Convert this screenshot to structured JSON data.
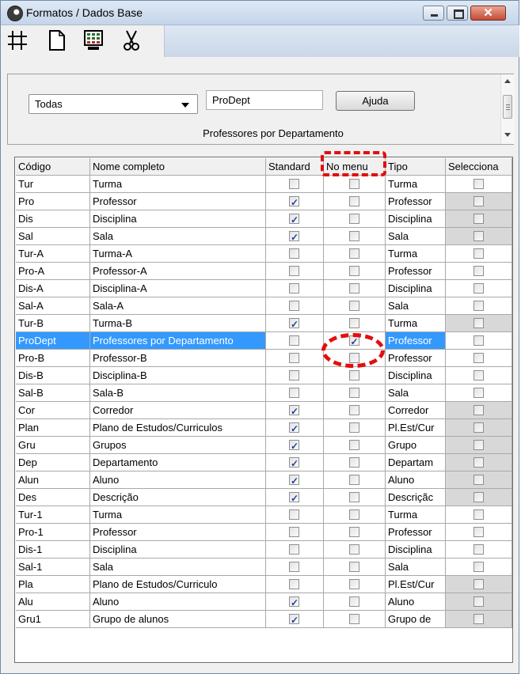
{
  "window": {
    "title": "Formatos / Dados Base",
    "icons": {
      "app": "app-clock-icon",
      "minimize": "minimize-icon",
      "maximize": "maximize-icon",
      "close": "close-icon"
    },
    "close_glyph": "✕"
  },
  "toolbar": {
    "icons": [
      "grid-icon",
      "new-document-icon",
      "monitor-icon",
      "scissors-icon"
    ]
  },
  "filter": {
    "category_selected": "Todas",
    "code_value": "ProDept",
    "help_label": "Ajuda",
    "description": "Professores por Departamento"
  },
  "grid": {
    "columns": [
      "Código",
      "Nome completo",
      "Standard",
      "No menu",
      "Tipo",
      "Selecciona"
    ],
    "rows": [
      {
        "code": "Tur",
        "name": "Turma",
        "standard": false,
        "menu": false,
        "type": "Turma",
        "select": false,
        "select_gray": false
      },
      {
        "code": "Pro",
        "name": "Professor",
        "standard": true,
        "menu": false,
        "type": "Professor",
        "select": false,
        "select_gray": true
      },
      {
        "code": "Dis",
        "name": "Disciplina",
        "standard": true,
        "menu": false,
        "type": "Disciplina",
        "select": false,
        "select_gray": true
      },
      {
        "code": "Sal",
        "name": "Sala",
        "standard": true,
        "menu": false,
        "type": "Sala",
        "select": false,
        "select_gray": true
      },
      {
        "code": "Tur-A",
        "name": "Turma-A",
        "standard": false,
        "menu": false,
        "type": "Turma",
        "select": false,
        "select_gray": false
      },
      {
        "code": "Pro-A",
        "name": "Professor-A",
        "standard": false,
        "menu": false,
        "type": "Professor",
        "select": false,
        "select_gray": false
      },
      {
        "code": "Dis-A",
        "name": "Disciplina-A",
        "standard": false,
        "menu": false,
        "type": "Disciplina",
        "select": false,
        "select_gray": false
      },
      {
        "code": "Sal-A",
        "name": "Sala-A",
        "standard": false,
        "menu": false,
        "type": "Sala",
        "select": false,
        "select_gray": false
      },
      {
        "code": "Tur-B",
        "name": "Turma-B",
        "standard": true,
        "menu": false,
        "type": "Turma",
        "select": false,
        "select_gray": true
      },
      {
        "code": "ProDept",
        "name": "Professores por Departamento",
        "standard": false,
        "menu": true,
        "type": "Professor",
        "select": false,
        "select_gray": false,
        "selected": true
      },
      {
        "code": "Pro-B",
        "name": "Professor-B",
        "standard": false,
        "menu": false,
        "type": "Professor",
        "select": false,
        "select_gray": false
      },
      {
        "code": "Dis-B",
        "name": "Disciplina-B",
        "standard": false,
        "menu": false,
        "type": "Disciplina",
        "select": false,
        "select_gray": false
      },
      {
        "code": "Sal-B",
        "name": "Sala-B",
        "standard": false,
        "menu": false,
        "type": "Sala",
        "select": false,
        "select_gray": false
      },
      {
        "code": "Cor",
        "name": "Corredor",
        "standard": true,
        "menu": false,
        "type": "Corredor",
        "select": false,
        "select_gray": true
      },
      {
        "code": "Plan",
        "name": "Plano de Estudos/Curriculos",
        "standard": true,
        "menu": false,
        "type": "Pl.Est/Cur",
        "select": false,
        "select_gray": true
      },
      {
        "code": "Gru",
        "name": "Grupos",
        "standard": true,
        "menu": false,
        "type": "Grupo",
        "select": false,
        "select_gray": true
      },
      {
        "code": "Dep",
        "name": "Departamento",
        "standard": true,
        "menu": false,
        "type": "Departam",
        "select": false,
        "select_gray": true
      },
      {
        "code": "Alun",
        "name": "Aluno",
        "standard": true,
        "menu": false,
        "type": "Aluno",
        "select": false,
        "select_gray": true
      },
      {
        "code": "Des",
        "name": "Descrição",
        "standard": true,
        "menu": false,
        "type": "Descriçãc",
        "select": false,
        "select_gray": true
      },
      {
        "code": "Tur-1",
        "name": "Turma",
        "standard": false,
        "menu": false,
        "type": "Turma",
        "select": false,
        "select_gray": false
      },
      {
        "code": "Pro-1",
        "name": "Professor",
        "standard": false,
        "menu": false,
        "type": "Professor",
        "select": false,
        "select_gray": false
      },
      {
        "code": "Dis-1",
        "name": "Disciplina",
        "standard": false,
        "menu": false,
        "type": "Disciplina",
        "select": false,
        "select_gray": false
      },
      {
        "code": "Sal-1",
        "name": "Sala",
        "standard": false,
        "menu": false,
        "type": "Sala",
        "select": false,
        "select_gray": false
      },
      {
        "code": "Pla",
        "name": "Plano de Estudos/Curriculo",
        "standard": false,
        "menu": false,
        "type": "Pl.Est/Cur",
        "select": false,
        "select_gray": true
      },
      {
        "code": "Alu",
        "name": "Aluno",
        "standard": true,
        "menu": false,
        "type": "Aluno",
        "select": false,
        "select_gray": true
      },
      {
        "code": "Gru1",
        "name": "Grupo de alunos",
        "standard": true,
        "menu": false,
        "type": "Grupo de",
        "select": false,
        "select_gray": true
      }
    ]
  },
  "colors": {
    "selection": "#3399ff",
    "annotation": "#e30e0e"
  }
}
